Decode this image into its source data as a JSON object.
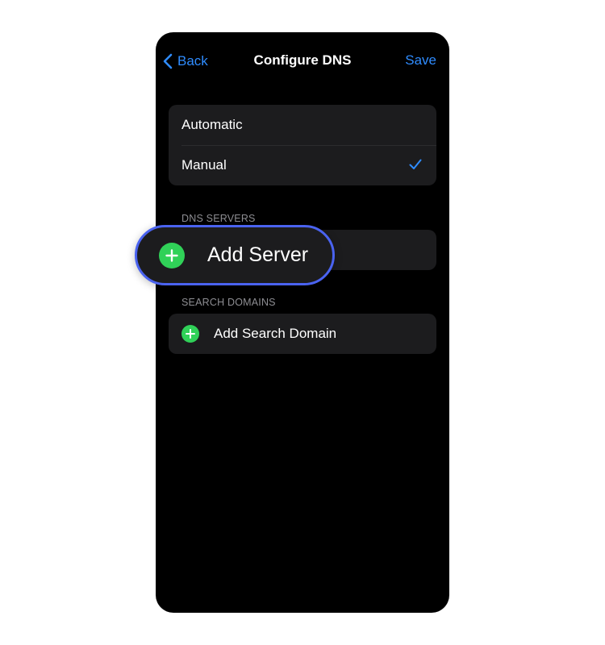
{
  "nav": {
    "back_label": "Back",
    "title": "Configure DNS",
    "save_label": "Save"
  },
  "mode_options": [
    {
      "label": "Automatic",
      "selected": false
    },
    {
      "label": "Manual",
      "selected": true
    }
  ],
  "dns_servers": {
    "header": "DNS SERVERS",
    "add_label": "Add Server"
  },
  "search_domains": {
    "header": "SEARCH DOMAINS",
    "add_label": "Add Search Domain"
  },
  "icons": {
    "back": "chevron-left-icon",
    "selected": "checkmark-icon",
    "add": "plus-circle-icon"
  },
  "colors": {
    "accent": "#2f8cff",
    "add_green": "#30d158",
    "highlight_border": "#4a63f0",
    "background": "#000000",
    "group_background": "#1c1c1e",
    "section_header": "#8e8e93"
  }
}
